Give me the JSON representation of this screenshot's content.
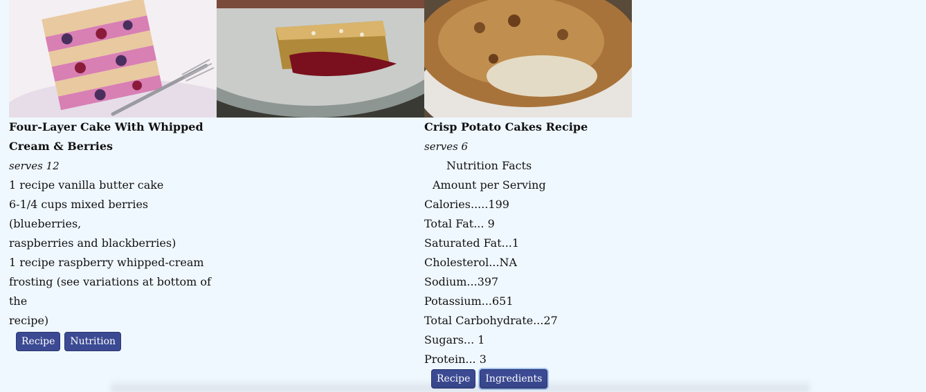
{
  "recipes": [
    {
      "title": "Four-Layer Cake With Whipped Cream & Berries",
      "serves": "serves 12",
      "lines": [
        "1 recipe vanilla butter cake",
        "6-1/4 cups mixed berries (blueberries,",
        "raspberries and blackberries)",
        "1 recipe raspberry whipped-cream",
        "frosting (see variations at bottom of the",
        "recipe)"
      ],
      "buttons": [
        "Recipe",
        "Nutrition"
      ]
    },
    {
      "title": "",
      "serves": "",
      "lines": [],
      "buttons": []
    },
    {
      "title": "Crisp Potato Cakes Recipe",
      "serves": "serves 6",
      "facts_head": "Nutrition Facts",
      "facts_sub": "Amount per Serving",
      "lines": [
        "Calories.....199",
        "Total Fat... 9",
        "Saturated Fat...1",
        "Cholesterol...NA",
        "Sodium...397",
        "Potassium...651",
        "Total Carbohydrate...27",
        "Sugars... 1",
        "Protein... 3"
      ],
      "buttons": [
        "Recipe",
        "Ingredients"
      ]
    }
  ],
  "colors": {
    "background": "#f0f8ff",
    "button": "#3b4a92"
  }
}
